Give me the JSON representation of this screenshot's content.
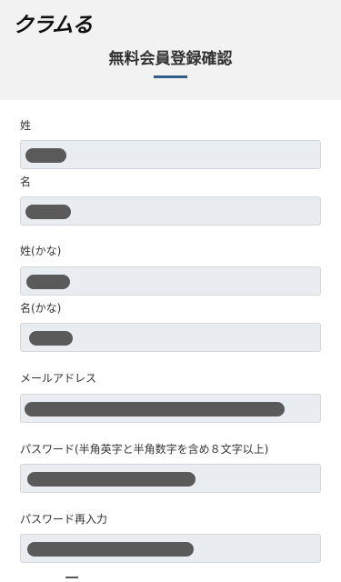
{
  "header": {
    "logo": "クラムる",
    "title": "無料会員登録確認"
  },
  "fields": [
    {
      "label": "姓"
    },
    {
      "label": "名"
    },
    {
      "label": "姓(かな)"
    },
    {
      "label": "名(かな)"
    },
    {
      "label": "メールアドレス"
    },
    {
      "label": "パスワード(半角英字と半角数字を含め８文字以上)"
    },
    {
      "label": "パスワード再入力"
    }
  ]
}
